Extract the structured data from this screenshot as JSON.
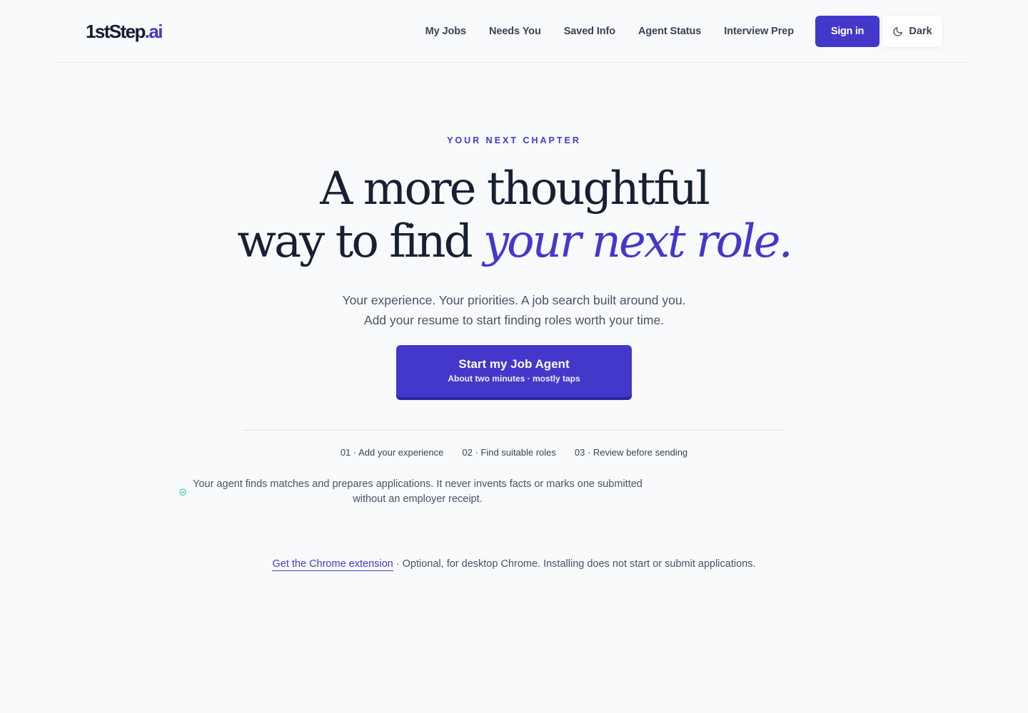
{
  "header": {
    "logo_main": "1stStep",
    "logo_accent": ".ai",
    "nav": [
      "My Jobs",
      "Needs You",
      "Saved Info",
      "Agent Status",
      "Interview Prep"
    ],
    "signin_label": "Sign in",
    "theme_label": "Dark",
    "theme_icon": "moon-icon"
  },
  "hero": {
    "eyebrow": "YOUR NEXT CHAPTER",
    "headline_line1": "A more thoughtful",
    "headline_line2_plain": "way to find",
    "headline_line2_emphasis": "your next role.",
    "subtext_line1": "Your experience. Your priorities. A job search built around you.",
    "subtext_line2": "Add your resume to start finding roles worth your time.",
    "cta_title": "Start my Job Agent",
    "cta_subtitle": "About two minutes · mostly taps"
  },
  "steps": [
    "01 · Add your experience",
    "02 · Find suitable roles",
    "03 · Review before sending"
  ],
  "trust": {
    "icon": "shield-icon",
    "text": "Your agent finds matches and prepares applications. It never invents facts or marks one submitted without an employer receipt."
  },
  "extension": {
    "link_label": "Get the Chrome extension",
    "note": " · Optional, for desktop Chrome. Installing does not start or submit applications."
  },
  "colors": {
    "accent": "#4338ca",
    "background": "#f8fafc",
    "text": "#172033",
    "shield": "#34d399"
  }
}
